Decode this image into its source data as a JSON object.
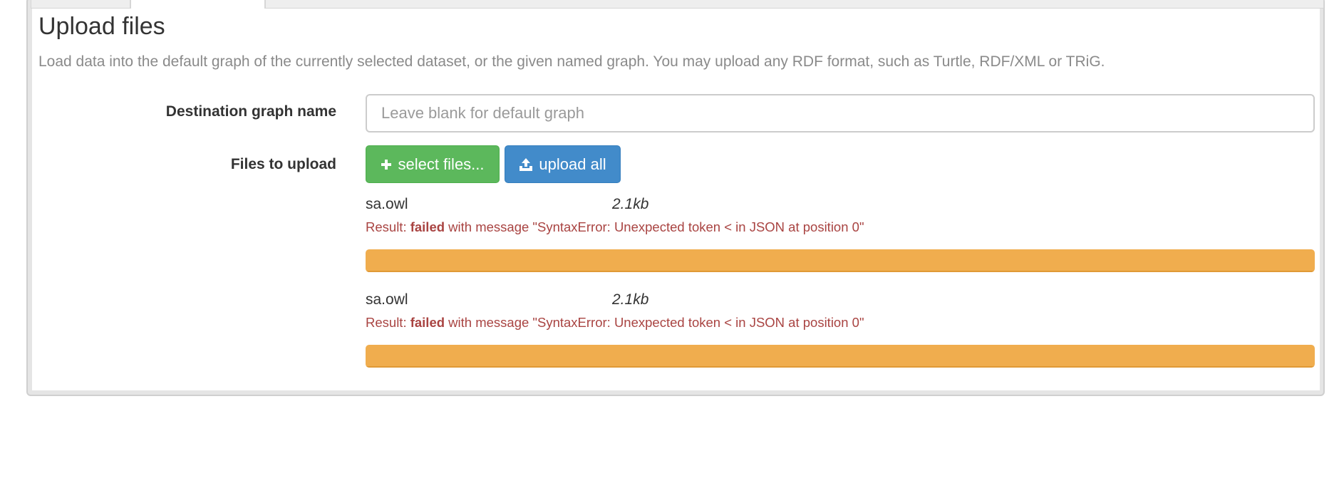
{
  "header": {
    "title": "Upload files"
  },
  "description": "Load data into the default graph of the currently selected dataset, or the given named graph. You may upload any RDF format, such as Turtle, RDF/XML or TRiG.",
  "form": {
    "destination_label": "Destination graph name",
    "destination_placeholder": "Leave blank for default graph",
    "destination_value": "",
    "files_label": "Files to upload",
    "select_button": "select files...",
    "upload_button": "upload all"
  },
  "files": [
    {
      "name": "sa.owl",
      "size": "2.1kb",
      "result_prefix": "Result: ",
      "status": "failed",
      "message": " with message \"SyntaxError: Unexpected token < in JSON at position 0\"",
      "progress": 1.0
    },
    {
      "name": "sa.owl",
      "size": "2.1kb",
      "result_prefix": "Result: ",
      "status": "failed",
      "message": " with message \"SyntaxError: Unexpected token < in JSON at position 0\"",
      "progress": 1.0
    }
  ],
  "colors": {
    "select_button": "#5cb85c",
    "upload_button": "#428bca",
    "progress_warning": "#f0ad4e",
    "error_text": "#a94442"
  },
  "icons": {
    "select": "plus-icon",
    "upload": "upload-icon"
  }
}
